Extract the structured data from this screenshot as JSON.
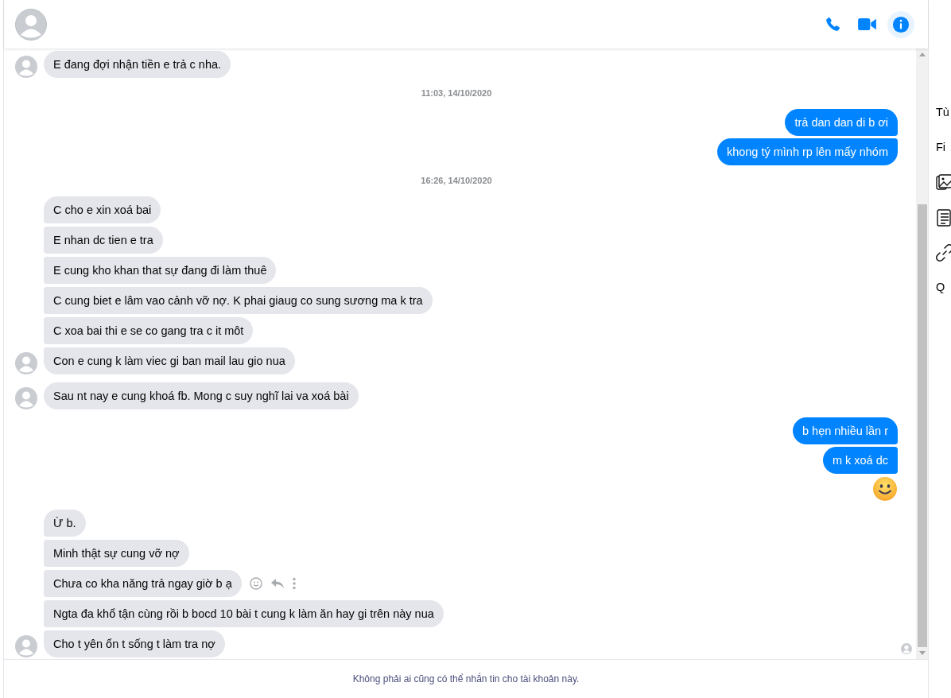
{
  "header": {
    "actions": [
      {
        "kind": "phone",
        "selected": false
      },
      {
        "kind": "video",
        "selected": false
      },
      {
        "kind": "info",
        "selected": true
      }
    ]
  },
  "thread": [
    {
      "kind": "incoming",
      "messages": [
        {
          "text": "E đang đợi nhận tiền e trả c nha."
        }
      ]
    },
    {
      "kind": "timestamp",
      "text": "11:03, 14/10/2020"
    },
    {
      "kind": "outgoing",
      "messages": [
        {
          "text": "trả dan dan di b ơi"
        },
        {
          "text": "khong tý mình rp lên mấy nhóm"
        }
      ]
    },
    {
      "kind": "timestamp",
      "text": "16:26, 14/10/2020"
    },
    {
      "kind": "incoming",
      "messages": [
        {
          "text": "C cho e xin xoá bai"
        },
        {
          "text": "E nhan dc tien e tra"
        },
        {
          "text": "E cung kho khan that sự đang đi làm thuê"
        },
        {
          "text": "C cung biet e lâm vao cảnh vỡ nợ. K phai giaug co sung sương ma k tra"
        },
        {
          "text": "C xoa bai thi e se co gang tra c it môt"
        },
        {
          "text": "Con e cung k làm viec gi ban mail lau gio nua"
        }
      ]
    },
    {
      "kind": "incoming",
      "messages": [
        {
          "text": "Sau nt nay e cung khoá fb. Mong c suy nghĩ lai va xoá bài"
        }
      ]
    },
    {
      "kind": "outgoing",
      "messages": [
        {
          "text": "b hẹn nhiều lần r"
        },
        {
          "text": "m k xoá dc"
        },
        {
          "kind": "emoji"
        }
      ]
    },
    {
      "kind": "incoming",
      "messages": [
        {
          "text": "Ừ b."
        },
        {
          "text": "Minh thật sự cung vỡ nợ"
        },
        {
          "text": "Chưa co kha năng trả ngay giờ b ạ",
          "hover_actions": true
        },
        {
          "text": "Ngta đa khổ tận cùng rồi b bocd 10 bài t cung k làm ăn hay gi trên này nua"
        },
        {
          "text": "Cho t yên ổn t sống t làm tra nợ"
        }
      ]
    }
  ],
  "footer": {
    "notice": "Không phải ai cũng có thể nhắn tin cho tài khoản này."
  },
  "sidebar": {
    "items": [
      {
        "kind": "text",
        "label": "Tù"
      },
      {
        "kind": "text",
        "label": "Fi"
      },
      {
        "kind": "media"
      },
      {
        "kind": "file"
      },
      {
        "kind": "link"
      },
      {
        "kind": "text",
        "label": "Q"
      }
    ]
  }
}
